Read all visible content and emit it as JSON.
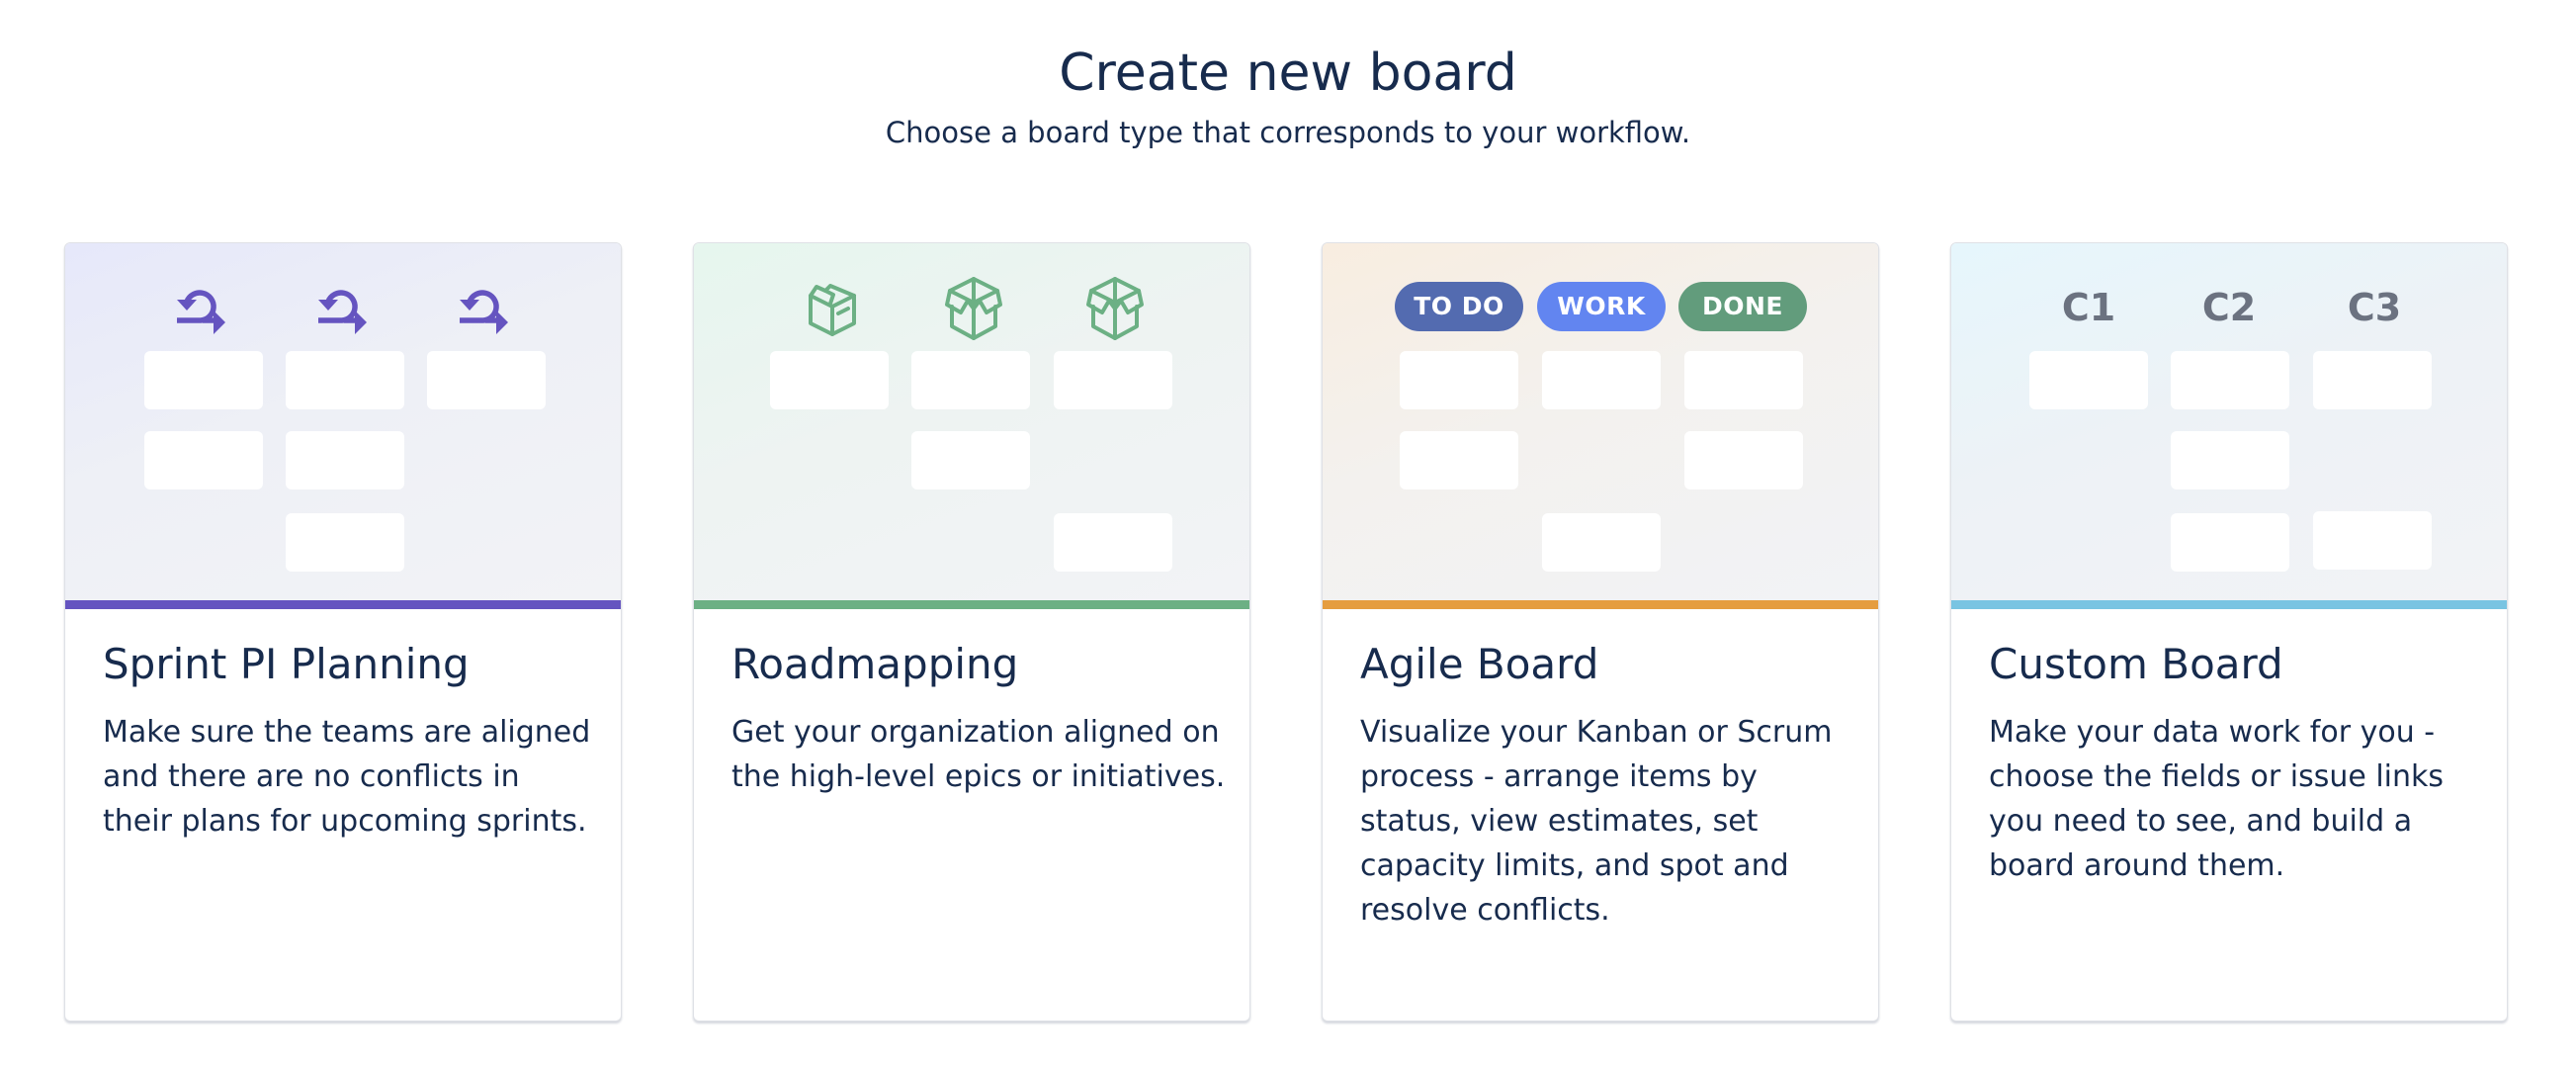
{
  "header": {
    "title": "Create new board",
    "subtitle": "Choose a board type that corresponds to your workflow."
  },
  "colors": {
    "text": "#172b4d",
    "sprint_accent": "#6554c0",
    "roadmap_accent": "#6cb084",
    "agile_accent": "#e59d3f",
    "custom_accent": "#79c4e2",
    "badge_todo": "#536bb0",
    "badge_work": "#6285f0",
    "badge_done": "#629c7c",
    "column_label": "#6b7280"
  },
  "cards": [
    {
      "id": "sprint-pi-planning",
      "title": "Sprint PI Planning",
      "description": "Make sure the teams are aligned and there are no conflicts in their plans for upcoming sprints.",
      "column_icon": "sprint-cycle-icon",
      "columns": 3
    },
    {
      "id": "roadmapping",
      "title": "Roadmapping",
      "description": "Get your organization aligned on the high-level epics or initiatives.",
      "column_icons": [
        "package-closed-icon",
        "package-open-icon",
        "package-open-icon"
      ],
      "columns": 3
    },
    {
      "id": "agile-board",
      "title": "Agile Board",
      "description": "Visualize your Kanban or Scrum process - arrange items by status, view estimates, set capacity limits, and spot and resolve conflicts.",
      "badges": [
        "TO DO",
        "WORK",
        "DONE"
      ],
      "columns": 3
    },
    {
      "id": "custom-board",
      "title": "Custom Board",
      "description": "Make your data work for you - choose the fields or issue links you need to see, and build a board around them.",
      "column_labels": [
        "C1",
        "C2",
        "C3"
      ],
      "columns": 3
    }
  ]
}
